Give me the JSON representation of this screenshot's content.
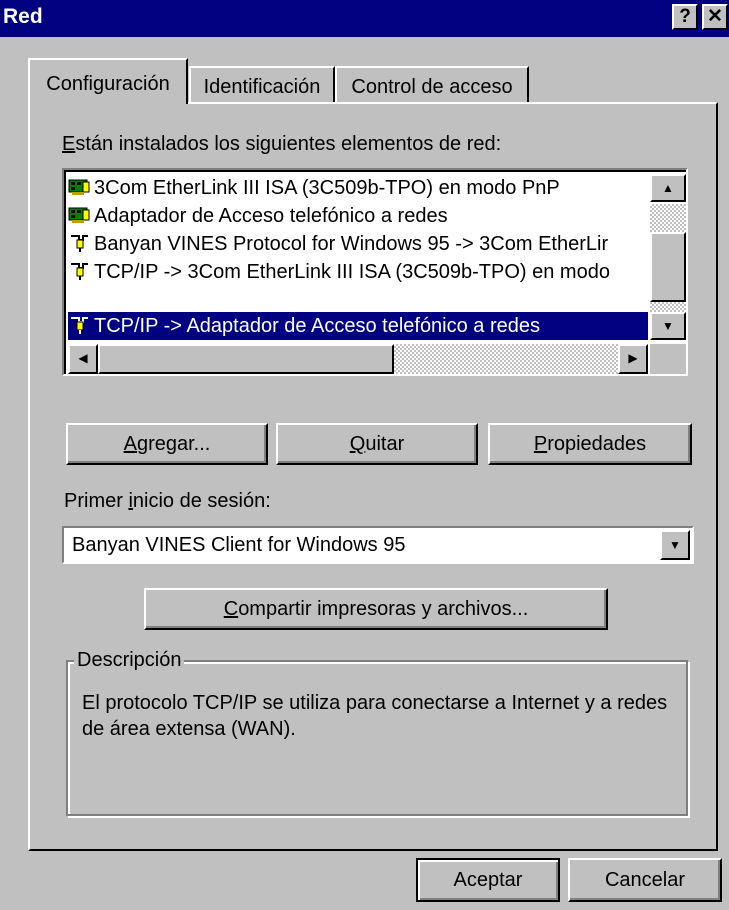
{
  "window": {
    "title": "Red",
    "help_glyph": "?",
    "close_glyph": "✕"
  },
  "tabs": [
    {
      "label": "Configuración",
      "active": true
    },
    {
      "label": "Identificación",
      "active": false
    },
    {
      "label": "Control de acceso",
      "active": false
    }
  ],
  "components": {
    "heading_prefix": "E",
    "heading_rest": "stán instalados los siguientes elementos de red:",
    "items": [
      {
        "icon": "network-card-icon",
        "label": "3Com EtherLink III ISA (3C509b-TPO) en modo PnP",
        "selected": false
      },
      {
        "icon": "network-card-icon",
        "label": "Adaptador de Acceso telefónico a redes",
        "selected": false
      },
      {
        "icon": "protocol-icon",
        "label": "Banyan VINES Protocol for Windows 95 -> 3Com EtherLir",
        "selected": false
      },
      {
        "icon": "protocol-icon",
        "label": "TCP/IP -> 3Com EtherLink III ISA (3C509b-TPO) en modo",
        "selected": false
      },
      {
        "icon": "protocol-icon",
        "label": "TCP/IP -> Adaptador de Acceso telefónico a redes",
        "selected": true
      }
    ]
  },
  "buttons": {
    "add_prefix": "A",
    "add_rest": "gregar...",
    "remove_prefix": "Q",
    "remove_rest": "uitar",
    "properties_prefix": "P",
    "properties_rest": "ropiedades",
    "share_prefix": "C",
    "share_rest": "ompartir impresoras y archivos...",
    "ok": "Aceptar",
    "cancel": "Cancelar"
  },
  "logon": {
    "label_a": "Primer ",
    "label_key": "i",
    "label_b": "nicio de sesión:",
    "value": "Banyan VINES Client for Windows 95"
  },
  "description": {
    "title": "Descripción",
    "text": "El protocolo TCP/IP se utiliza para conectarse a Internet y a redes de área extensa (WAN)."
  }
}
